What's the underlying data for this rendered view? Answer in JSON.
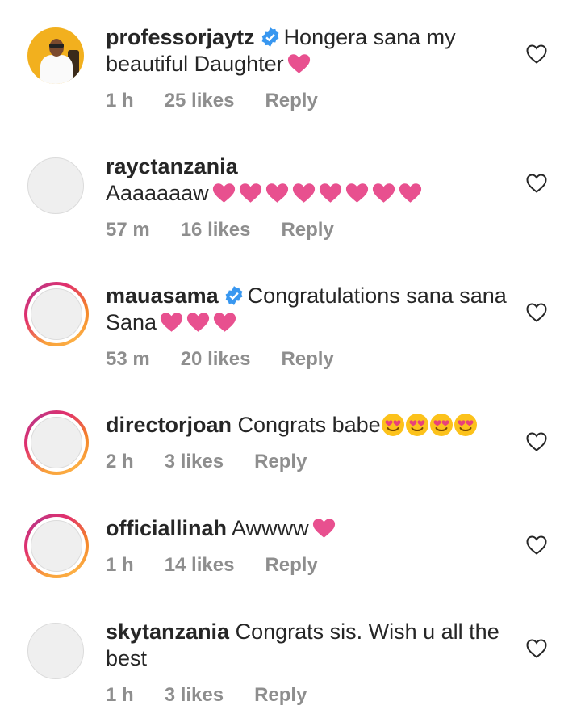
{
  "comments": [
    {
      "username": "professorjaytz",
      "verified": true,
      "text": "Hongera sana my beautiful Daughter",
      "hearts": 1,
      "emojis": 0,
      "time": "1 h",
      "likes": "25 likes",
      "reply": "Reply"
    },
    {
      "username": "rayctanzania",
      "verified": false,
      "text": "Aaaaaaaw",
      "hearts": 8,
      "emojis": 0,
      "time": "57 m",
      "likes": "16 likes",
      "reply": "Reply"
    },
    {
      "username": "mauasama",
      "verified": true,
      "text": "Congratulations sana sana Sana",
      "hearts": 3,
      "emojis": 0,
      "time": "53 m",
      "likes": "20 likes",
      "reply": "Reply"
    },
    {
      "username": "directorjoan",
      "verified": false,
      "text": "Congrats babe",
      "hearts": 0,
      "emojis": 4,
      "time": "2 h",
      "likes": "3 likes",
      "reply": "Reply"
    },
    {
      "username": "officiallinah",
      "verified": false,
      "text": "Awwww",
      "hearts": 1,
      "emojis": 0,
      "time": "1 h",
      "likes": "14 likes",
      "reply": "Reply"
    },
    {
      "username": "skytanzania",
      "verified": false,
      "text": "Congrats sis. Wish u all the best",
      "hearts": 0,
      "emojis": 0,
      "time": "1 h",
      "likes": "3 likes",
      "reply": "Reply"
    }
  ],
  "colors": {
    "heart": "#e8508f",
    "verified": "#3897f0",
    "meta": "#8e8e8e",
    "text": "#262626"
  },
  "icons": {
    "like": "heart-outline-icon",
    "verified": "verified-badge-icon",
    "heart_emoji": "pink-heart-emoji",
    "face_emoji": "heart-eyes-emoji"
  }
}
